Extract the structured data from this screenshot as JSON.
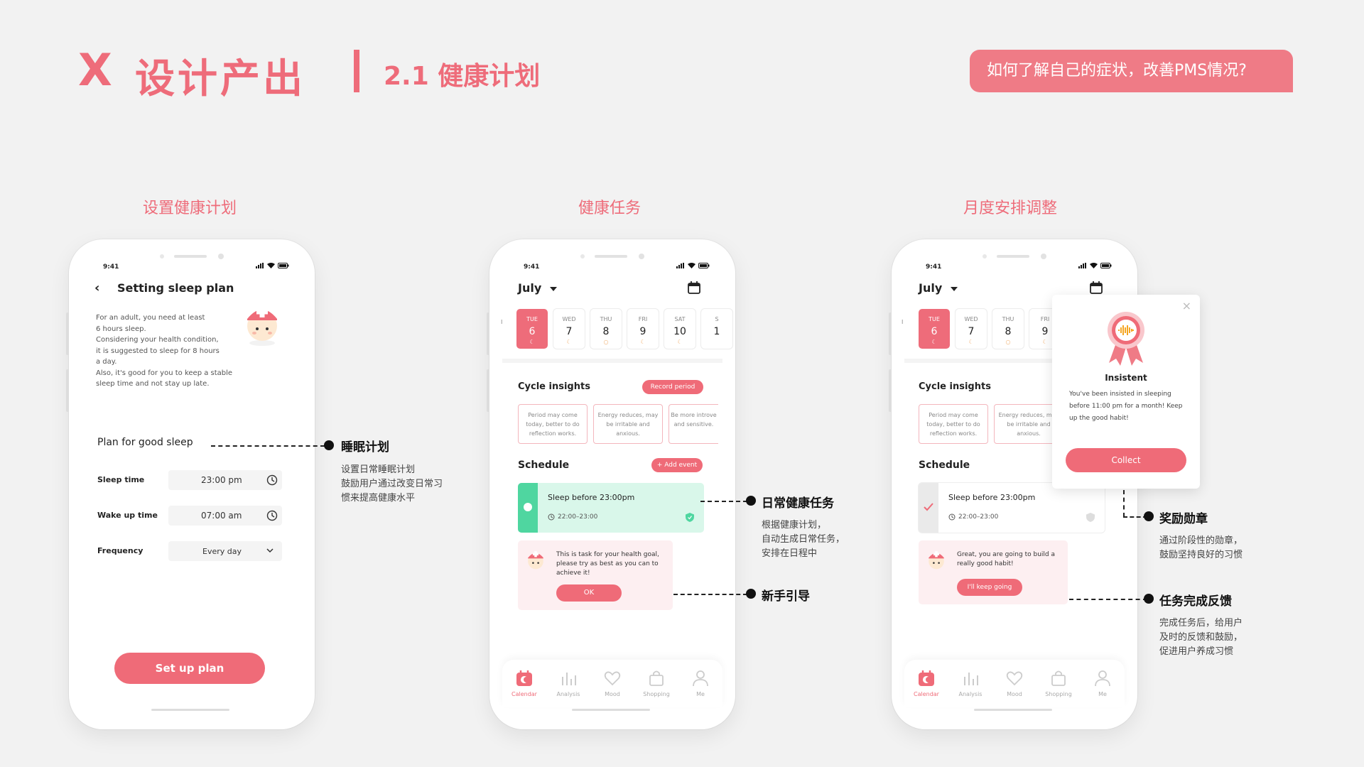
{
  "header": {
    "x_mark": "X",
    "title": "设计产出",
    "divider": "|",
    "subtitle": "2.1 健康计划",
    "question": "如何了解自己的症状，改善PMS情况?"
  },
  "sections": {
    "one": "设置健康计划",
    "two": "健康任务",
    "three": "月度安排调整"
  },
  "status_time": "9:41",
  "phone1": {
    "nav_title": "Setting sleep plan",
    "intro": "For an adult, you need at least\n6 hours sleep.\nConsidering your health condition,\nit is suggested to sleep for 8 hours\na day.\nAlso, it's good for you to keep a stable\nsleep time and not stay up late.",
    "plan_title": "Plan for good sleep",
    "sleep_label": "Sleep time",
    "sleep_value": "23:00 pm",
    "wake_label": "Wake up time",
    "wake_value": "07:00 am",
    "freq_label": "Frequency",
    "freq_value": "Every day",
    "cta": "Set up plan"
  },
  "calendar": {
    "month": "July",
    "days": [
      {
        "dow": "TUE",
        "num": "6"
      },
      {
        "dow": "WED",
        "num": "7"
      },
      {
        "dow": "THU",
        "num": "8"
      },
      {
        "dow": "FRI",
        "num": "9"
      },
      {
        "dow": "SAT",
        "num": "10"
      },
      {
        "dow": "S",
        "num": "1"
      }
    ],
    "left_peek": "I"
  },
  "phone2": {
    "cycle_title": "Cycle insights",
    "record_btn": "Record period",
    "insight1": "Period may come today, better to do reflection works.",
    "insight2": "Energy reduces, may be irritable and anxious.",
    "insight3": "Be more introve and sensitive.",
    "schedule_title": "Schedule",
    "add_event": "+ Add event",
    "task_title": "Sleep before 23:00pm",
    "task_time": "22:00–23:00",
    "guide_text": "This is task for your health goal, please try as best as you can to achieve it!",
    "guide_ok": "OK"
  },
  "phone3": {
    "cycle_title": "Cycle insights",
    "insight1": "Period may come today, better to do reflection works.",
    "insight2": "Energy reduces, may be irritable and anxious.",
    "schedule_title": "Schedule",
    "task_title": "Sleep before 23:00pm",
    "task_time": "22:00–23:00",
    "feedback_text": "Great, you are going to build a really good habit!",
    "feedback_btn": "I'll keep going",
    "popup_title": "Insistent",
    "popup_text": "You've been insisted in sleeping before 11:00 pm for a month! Keep up the good habit!",
    "popup_btn": "Collect",
    "popup_close": "×"
  },
  "tabs": [
    "Calendar",
    "Analysis",
    "Mood",
    "Shopping",
    "Me"
  ],
  "annotations": {
    "sleep_plan_title": "睡眠计划",
    "sleep_plan_desc": "设置日常睡眠计划\n鼓励用户通过改变日常习\n惯来提高健康水平",
    "daily_task_title": "日常健康任务",
    "daily_task_desc": "根据健康计划，\n自动生成日常任务，\n安排在日程中",
    "guide_title": "新手引导",
    "medal_title": "奖励勋章",
    "medal_desc": "通过阶段性的勋章，\n鼓励坚持良好的习惯",
    "feedback_title": "任务完成反馈",
    "feedback_desc": "完成任务后，给用户\n及时的反馈和鼓励，\n促进用户养成习惯"
  },
  "colors": {
    "accent": "#ee6c7a",
    "mint": "#d9f7ea",
    "mint_dark": "#4fd6a0",
    "light_pink": "#fdeff1"
  }
}
